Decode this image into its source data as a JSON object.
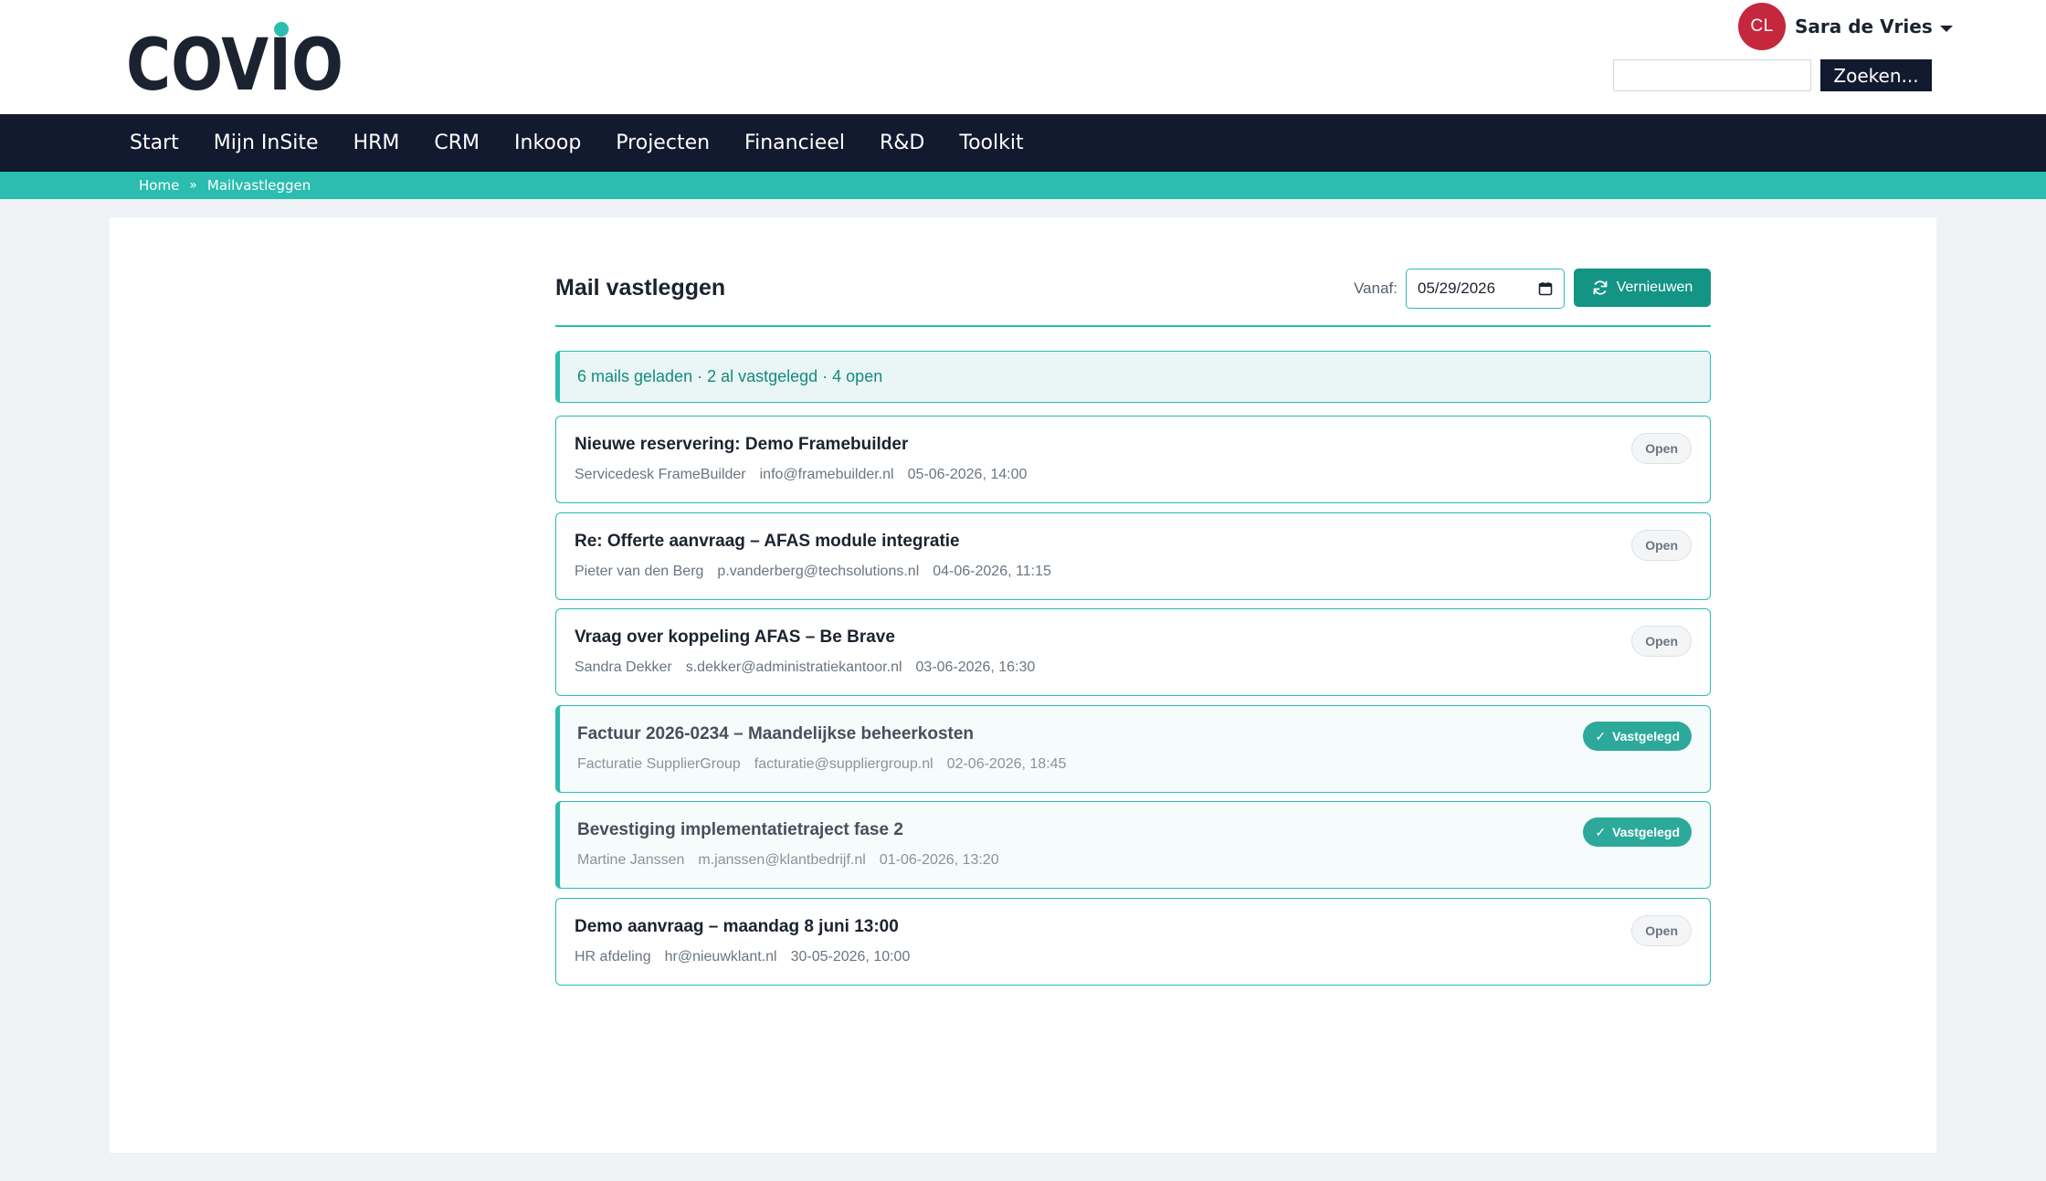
{
  "brand": {
    "logo_text": "COVIO",
    "accent": "#2bbdaf",
    "dark": "#111a2e"
  },
  "user": {
    "initials": "CL",
    "name": "Sara de Vries",
    "avatar_color": "#c5283d"
  },
  "search": {
    "value": "",
    "button_label": "Zoeken..."
  },
  "nav": {
    "items": [
      "Start",
      "Mijn InSite",
      "HRM",
      "CRM",
      "Inkoop",
      "Projecten",
      "Financieel",
      "R&D",
      "Toolkit"
    ]
  },
  "breadcrumb": {
    "home": "Home",
    "separator": "»",
    "current": "Mailvastleggen"
  },
  "page": {
    "title": "Mail vastleggen",
    "from_label": "Vanaf:",
    "from_date": "05/29/2026",
    "refresh_label": "Vernieuwen",
    "summary": "6 mails geladen · 2 al vastgelegd · 4 open"
  },
  "mails": [
    {
      "subject": "Nieuwe reservering: Demo Framebuilder",
      "sender": "Servicedesk FrameBuilder",
      "email": "info@framebuilder.nl",
      "date": "05-06-2026, 14:00",
      "status": "Open",
      "done": false
    },
    {
      "subject": "Re: Offerte aanvraag – AFAS module integratie",
      "sender": "Pieter van den Berg",
      "email": "p.vanderberg@techsolutions.nl",
      "date": "04-06-2026, 11:15",
      "status": "Open",
      "done": false
    },
    {
      "subject": "Vraag over koppeling AFAS – Be Brave",
      "sender": "Sandra Dekker",
      "email": "s.dekker@administratiekantoor.nl",
      "date": "03-06-2026, 16:30",
      "status": "Open",
      "done": false
    },
    {
      "subject": "Factuur 2026-0234 – Maandelijkse beheerkosten",
      "sender": "Facturatie SupplierGroup",
      "email": "facturatie@suppliergroup.nl",
      "date": "02-06-2026, 18:45",
      "status": "Vastgelegd",
      "done": true
    },
    {
      "subject": "Bevestiging implementatietraject fase 2",
      "sender": "Martine Janssen",
      "email": "m.janssen@klantbedrijf.nl",
      "date": "01-06-2026, 13:20",
      "status": "Vastgelegd",
      "done": true
    },
    {
      "subject": "Demo aanvraag – maandag 8 juni 13:00",
      "sender": "HR afdeling",
      "email": "hr@nieuwklant.nl",
      "date": "30-05-2026, 10:00",
      "status": "Open",
      "done": false
    }
  ]
}
